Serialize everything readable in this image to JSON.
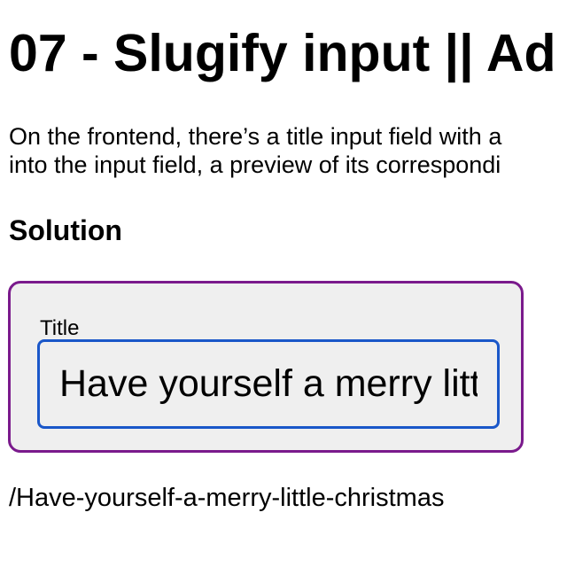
{
  "page": {
    "title": "07 - Slugify input || Ad",
    "intro_line_1": "On the frontend, there’s a title input field with a",
    "intro_line_2": "into the input field, a preview of its correspondi",
    "section_heading": "Solution"
  },
  "form": {
    "title_label": "Title",
    "title_value": "Have yourself a merry little christmas"
  },
  "preview": {
    "slug": "/Have-yourself-a-merry-little-christmas"
  },
  "colors": {
    "box_border": "#7a1a8c",
    "input_focus_border": "#1a57c9",
    "box_background": "#efefef"
  }
}
